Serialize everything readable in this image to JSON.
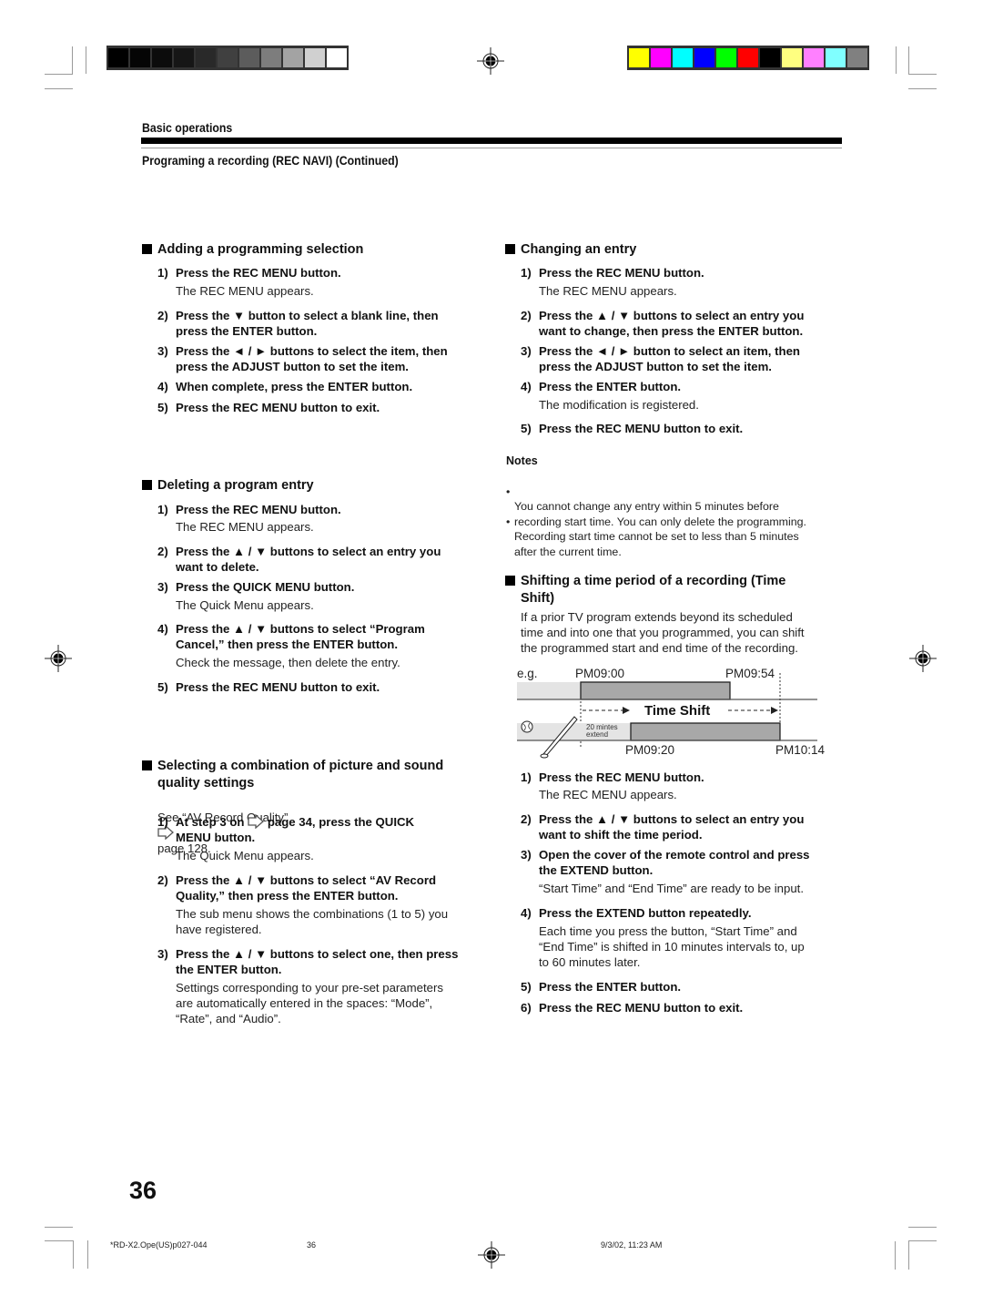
{
  "calibration": {
    "grayscale_swatches": [
      "#000000",
      "#050505",
      "#0c0c0c",
      "#161616",
      "#292929",
      "#404040",
      "#5c5c5c",
      "#7d7d7d",
      "#a3a3a3",
      "#d0d0d0",
      "#ffffff"
    ],
    "color_swatches": [
      "#ffff00",
      "#ff00ff",
      "#00ffff",
      "#0000ff",
      "#00ff00",
      "#ff0000",
      "#000000",
      "#ffff80",
      "#ff80ff",
      "#80ffff",
      "#808080"
    ]
  },
  "header": {
    "section": "Basic operations",
    "subtitle": "Programing a recording (REC NAVI) (Continued)"
  },
  "sections": {
    "adding": {
      "title": "Adding a programming selection",
      "steps": [
        {
          "num": "1)",
          "instruction": "Press the REC MENU button.",
          "detail": "The REC MENU appears."
        },
        {
          "num": "2)",
          "instruction": "Press the ▼ button to select a blank line, then\npress the ENTER button."
        },
        {
          "num": "3)",
          "instruction": "Press the ◄ / ► buttons to select the item, then\npress the ADJUST button to set the item."
        },
        {
          "num": "4)",
          "instruction": "When complete, press the ENTER button."
        },
        {
          "num": "5)",
          "instruction": "Press the REC MENU button to exit."
        }
      ]
    },
    "deleting": {
      "title": "Deleting a program entry",
      "steps": [
        {
          "num": "1)",
          "instruction": "Press the REC MENU button.",
          "detail": "The REC MENU appears."
        },
        {
          "num": "2)",
          "instruction": "Press the ▲ / ▼ buttons to select an entry you\nwant to delete."
        },
        {
          "num": "3)",
          "instruction": "Press the QUICK MENU button.",
          "detail": "The Quick Menu appears."
        },
        {
          "num": "4)",
          "instruction": "Press the ▲ / ▼ buttons to select “Program\nCancel,” then press the ENTER button.",
          "detail": "Check the message, then delete the entry."
        },
        {
          "num": "5)",
          "instruction": "Press the REC MENU button to exit."
        }
      ]
    },
    "selecting": {
      "title_line1": "Selecting a combination of picture and sound",
      "title_line2": "quality settings",
      "see_prefix": "See “AV Record Quality”",
      "see_suffix": "page 128.",
      "steps": [
        {
          "num": "1)",
          "instruction_prefix": "At step 3 on",
          "instruction_suffix": "page 34, press the QUICK",
          "instruction_line2": "MENU button.",
          "detail": "The Quick Menu appears."
        },
        {
          "num": "2)",
          "instruction": "Press the ▲ / ▼ buttons to select “AV Record\nQuality,” then press the ENTER button.",
          "detail": "The sub menu shows the combinations (1 to 5) you\nhave registered."
        },
        {
          "num": "3)",
          "instruction": "Press the ▲ / ▼ buttons to select one, then press\nthe ENTER button.",
          "detail": "Settings corresponding to your pre-set parameters\nare automatically entered in the spaces: “Mode”,\n“Rate”, and “Audio”."
        }
      ]
    },
    "changing": {
      "title": "Changing an entry",
      "steps": [
        {
          "num": "1)",
          "instruction": "Press the REC MENU button.",
          "detail": "The REC MENU appears."
        },
        {
          "num": "2)",
          "instruction": "Press the ▲ / ▼ buttons to select an entry you\nwant to change, then press the ENTER button."
        },
        {
          "num": "3)",
          "instruction": "Press the ◄ / ► button to select an item, then\npress the ADJUST button to set the item."
        },
        {
          "num": "4)",
          "instruction": "Press the ENTER button.",
          "detail": "The modification is registered."
        },
        {
          "num": "5)",
          "instruction": "Press the REC MENU button to exit."
        }
      ],
      "notes_title": "Notes",
      "notes": [
        "You cannot change any entry within 5 minutes before\nrecording start time. You can only delete the programming.",
        "Recording start time cannot be set to less than 5 minutes\nafter the current time."
      ]
    },
    "timeshift": {
      "title_line1": "Shifting a time period of a recording (Time",
      "title_line2": "Shift)",
      "intro": "If a prior TV program extends beyond its scheduled\ntime and into one that you programmed, you can shift\nthe programmed start and end time of the recording.",
      "diagram": {
        "eg": "e.g.",
        "orig_start": "PM09:00",
        "orig_end": "PM09:54",
        "label": "Time Shift",
        "extend_note_line1": "20 mintes",
        "extend_note_line2": "extend",
        "new_start": "PM09:20",
        "new_end": "PM10:14"
      },
      "steps": [
        {
          "num": "1)",
          "instruction": "Press the REC MENU button.",
          "detail": "The REC MENU appears."
        },
        {
          "num": "2)",
          "instruction": "Press the ▲ / ▼ buttons to select an entry you\nwant to shift the time period."
        },
        {
          "num": "3)",
          "instruction": "Open the cover of the remote control and press\nthe EXTEND button.",
          "detail": "“Start Time” and “End Time” are ready to be input."
        },
        {
          "num": "4)",
          "instruction": "Press the EXTEND button repeatedly.",
          "detail": "Each time you press the button, “Start Time” and\n“End Time” is shifted in 10 minutes intervals to, up\nto 60 minutes later."
        },
        {
          "num": "5)",
          "instruction": "Press the ENTER button."
        },
        {
          "num": "6)",
          "instruction": "Press the REC MENU button to exit."
        }
      ]
    }
  },
  "footer": {
    "page_number": "36",
    "file_name": "*RD-X2.Ope(US)p027-044",
    "sheet": "36",
    "timestamp": "9/3/02, 11:23 AM"
  }
}
